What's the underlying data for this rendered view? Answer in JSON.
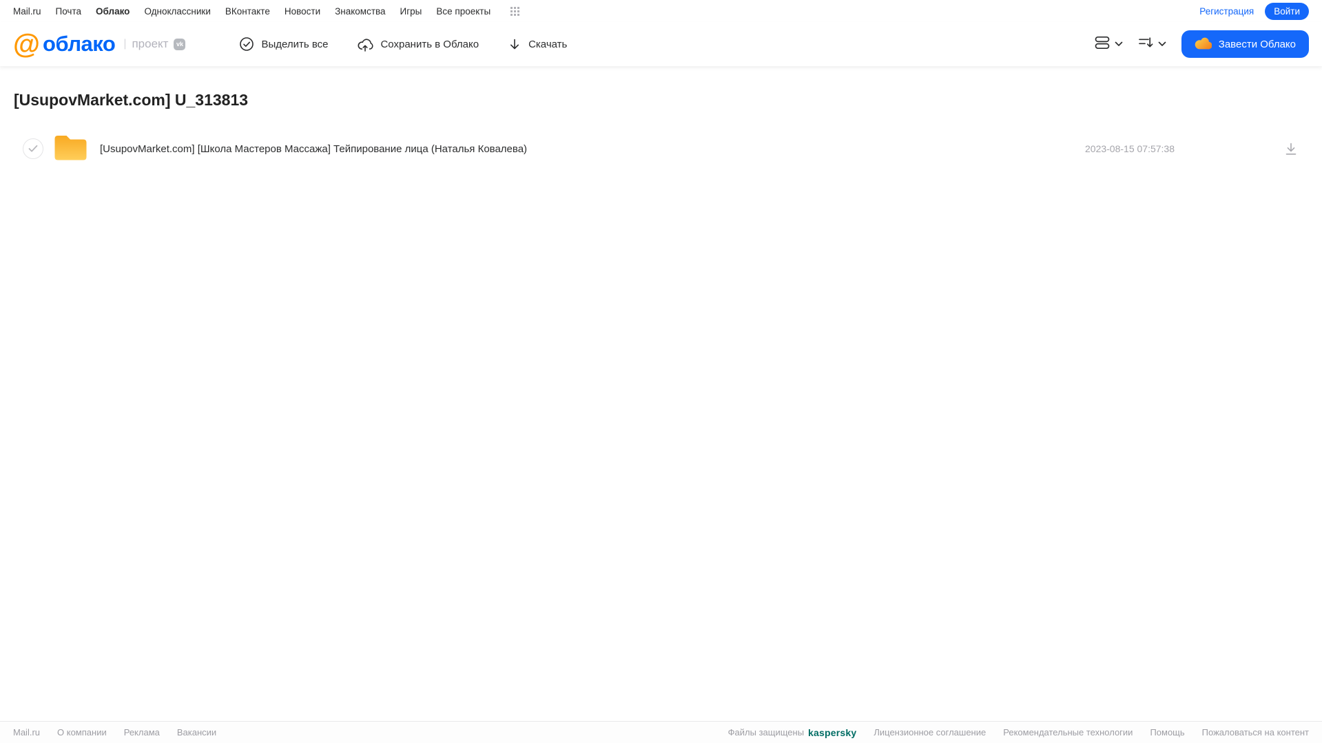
{
  "topnav": {
    "links": [
      "Mail.ru",
      "Почта",
      "Облако",
      "Одноклассники",
      "ВКонтакте",
      "Новости",
      "Знакомства",
      "Игры",
      "Все проекты"
    ],
    "active_link": "Облако",
    "registration_label": "Регистрация",
    "login_label": "Войти"
  },
  "header": {
    "logo": {
      "at_symbol": "@",
      "word": "облако",
      "divider": "|",
      "project_label": "проект",
      "vk_badge": "vk"
    },
    "toolbar": {
      "select_all_label": "Выделить все",
      "save_to_cloud_label": "Сохранить в Облако",
      "download_label": "Скачать"
    },
    "get_cloud_label": "Завести Облако"
  },
  "main": {
    "title": "[UsupovMarket.com] U_313813",
    "files": [
      {
        "type": "folder",
        "name": "[UsupovMarket.com] [Школа Мастеров Массажа] Тейпирование лица (Наталья Ковалева)",
        "modified": "2023-08-15 07:57:38"
      }
    ]
  },
  "footer": {
    "left_links": [
      "Mail.ru",
      "О компании",
      "Реклама",
      "Вакансии"
    ],
    "protected_label": "Файлы защищены",
    "kaspersky_label": "kaspersky",
    "right_links": [
      "Лицензионное соглашение",
      "Рекомендательные технологии",
      "Помощь",
      "Пожаловаться на контент"
    ]
  },
  "icons": {
    "apps_grid": "apps-grid-icon",
    "select_all": "check-circle-icon",
    "save_cloud": "cloud-upload-icon",
    "download": "download-arrow-icon",
    "view_toggle": "list-view-icon",
    "sort": "sort-icon",
    "chevron": "chevron-down-icon",
    "cloud_brand": "cloud-icon",
    "folder": "folder-icon",
    "row_download": "download-icon"
  },
  "colors": {
    "accent_blue": "#1568fa",
    "logo_blue": "#0066f9",
    "logo_orange": "#ff9800",
    "folder_gradient_top": "#f8a922",
    "folder_gradient_bottom": "#ffce5a",
    "kaspersky_teal": "#006d64",
    "muted_gray": "#a5a5ab"
  }
}
